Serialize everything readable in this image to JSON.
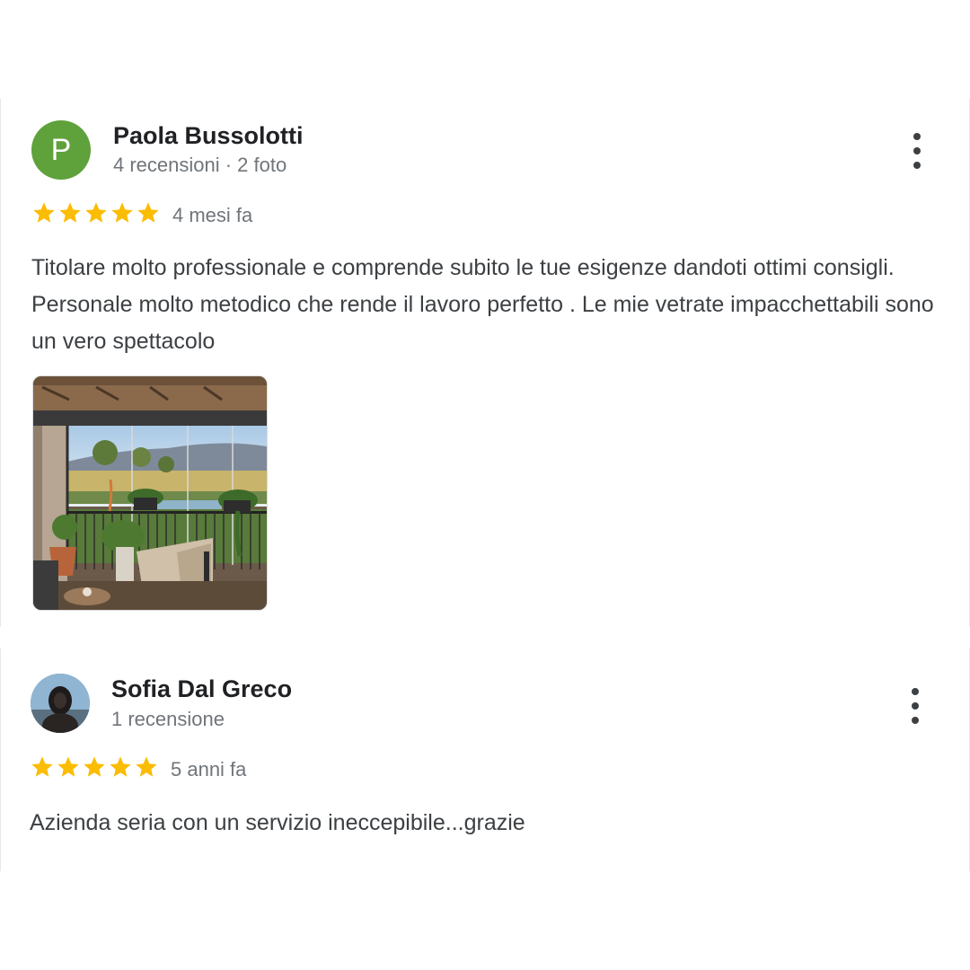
{
  "reviews": [
    {
      "avatar_letter": "P",
      "name": "Paola Bussolotti",
      "meta": "4 recensioni · 2 foto",
      "rating": 5,
      "time": "4 mesi fa",
      "text": "Titolare molto professionale e comprende subito le tue esigenze dandoti ottimi consigli. Personale molto metodico che rende il lavoro perfetto . Le mie vetrate impacchettabili sono un vero spettacolo"
    },
    {
      "name": "Sofia Dal Greco",
      "meta": "1 recensione",
      "rating": 5,
      "time": "5 anni fa",
      "text": "Azienda seria con un servizio ineccepibile...grazie"
    }
  ],
  "icons": {
    "star": "star-icon",
    "menu": "more-vert-icon"
  },
  "colors": {
    "star": "#fbbc04",
    "avatar_bg": "#5fa13a"
  }
}
